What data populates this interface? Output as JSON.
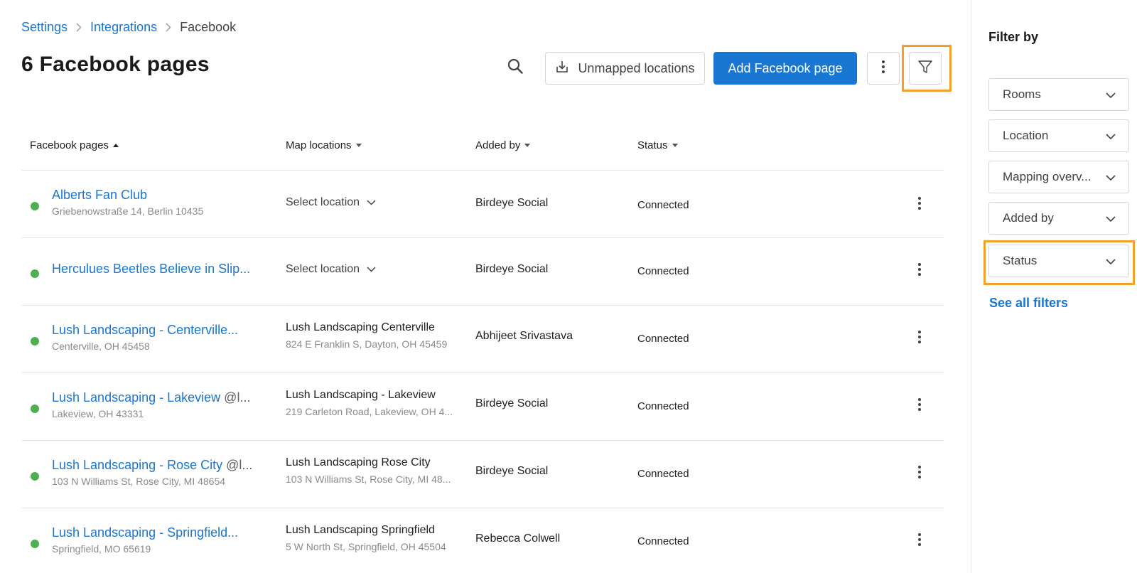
{
  "breadcrumb": {
    "items": [
      "Settings",
      "Integrations"
    ],
    "current": "Facebook"
  },
  "page_title": "6 Facebook pages",
  "toolbar": {
    "unmapped_label": "Unmapped locations",
    "add_label": "Add Facebook page"
  },
  "table": {
    "headers": {
      "pages": "Facebook pages",
      "locations": "Map locations",
      "added_by": "Added by",
      "status": "Status"
    },
    "rows": [
      {
        "name": "Alberts Fan Club",
        "handle": "",
        "address": "Griebenowstraße 14, Berlin 10435",
        "location_name": "",
        "location_address": "",
        "select_label": "Select location",
        "added_by": "Birdeye Social",
        "status": "Connected"
      },
      {
        "name": "Herculues Beetles Believe in Slip...",
        "handle": "",
        "address": "",
        "location_name": "",
        "location_address": "",
        "select_label": "Select location",
        "added_by": "Birdeye Social",
        "status": "Connected"
      },
      {
        "name": "Lush Landscaping - Centerville...",
        "handle": "",
        "address": "Centerville, OH 45458",
        "location_name": "Lush Landscaping Centerville",
        "location_address": "824 E Franklin S, Dayton, OH 45459",
        "select_label": "",
        "added_by": "Abhijeet Srivastava",
        "status": "Connected"
      },
      {
        "name": "Lush Landscaping - Lakeview",
        "handle": "@l...",
        "address": "Lakeview, OH 43331",
        "location_name": "Lush Landscaping - Lakeview",
        "location_address": "219 Carleton Road, Lakeview, OH 4...",
        "select_label": "",
        "added_by": "Birdeye Social",
        "status": "Connected"
      },
      {
        "name": "Lush Landscaping - Rose City",
        "handle": "@l...",
        "address": "103 N Williams St, Rose City, MI 48654",
        "location_name": "Lush Landscaping Rose City",
        "location_address": "103 N Williams St, Rose City, MI 48...",
        "select_label": "",
        "added_by": "Birdeye Social",
        "status": "Connected"
      },
      {
        "name": "Lush Landscaping - Springfield...",
        "handle": "",
        "address": "Springfield, MO 65619",
        "location_name": "Lush Landscaping Springfield",
        "location_address": "5 W North St, Springfield, OH 45504",
        "select_label": "",
        "added_by": "Rebecca Colwell",
        "status": "Connected"
      }
    ]
  },
  "sidebar": {
    "title": "Filter by",
    "filters": [
      "Rooms",
      "Location",
      "Mapping overv...",
      "Added by",
      "Status"
    ],
    "see_all": "See all filters"
  },
  "colors": {
    "accent": "#1976d2",
    "highlight": "#f5a02a",
    "status_connected": "#4caf50"
  }
}
